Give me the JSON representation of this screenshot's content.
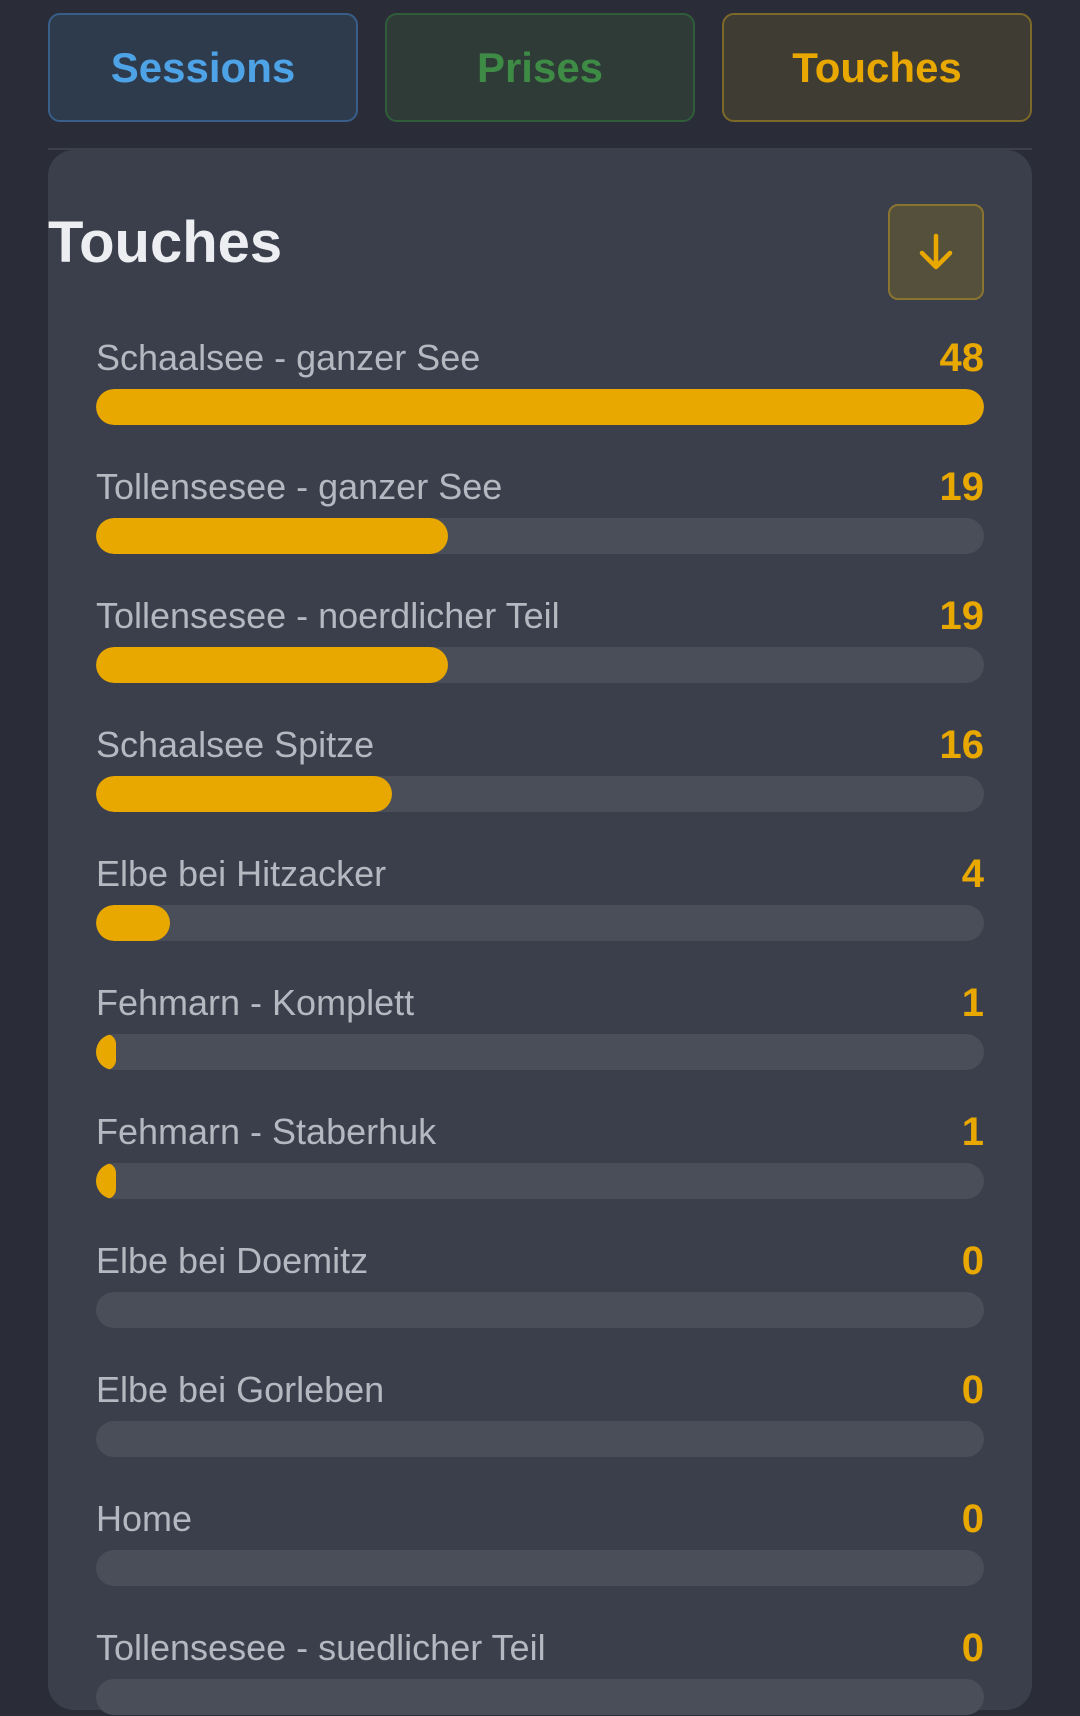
{
  "tabs": [
    {
      "label": "Sessions"
    },
    {
      "label": "Prises"
    },
    {
      "label": "Touches"
    }
  ],
  "active_tab": "Touches",
  "card": {
    "title": "Touches",
    "download_icon": "arrow-down-icon"
  },
  "colors": {
    "accent": "#e8a800",
    "sessions": "#4ea3e6",
    "prises": "#3d8b45",
    "track": "#4a4e58"
  },
  "rows": [
    {
      "label": "Schaalsee - ganzer See",
      "value": 48
    },
    {
      "label": "Tollensesee - ganzer See",
      "value": 19
    },
    {
      "label": "Tollensesee - noerdlicher Teil",
      "value": 19
    },
    {
      "label": "Schaalsee Spitze",
      "value": 16
    },
    {
      "label": "Elbe bei Hitzacker",
      "value": 4
    },
    {
      "label": "Fehmarn - Komplett",
      "value": 1
    },
    {
      "label": "Fehmarn - Staberhuk",
      "value": 1
    },
    {
      "label": "Elbe bei Doemitz",
      "value": 0
    },
    {
      "label": "Elbe bei Gorleben",
      "value": 0
    },
    {
      "label": "Home",
      "value": 0
    },
    {
      "label": "Tollensesee - suedlicher Teil",
      "value": 0
    }
  ]
}
